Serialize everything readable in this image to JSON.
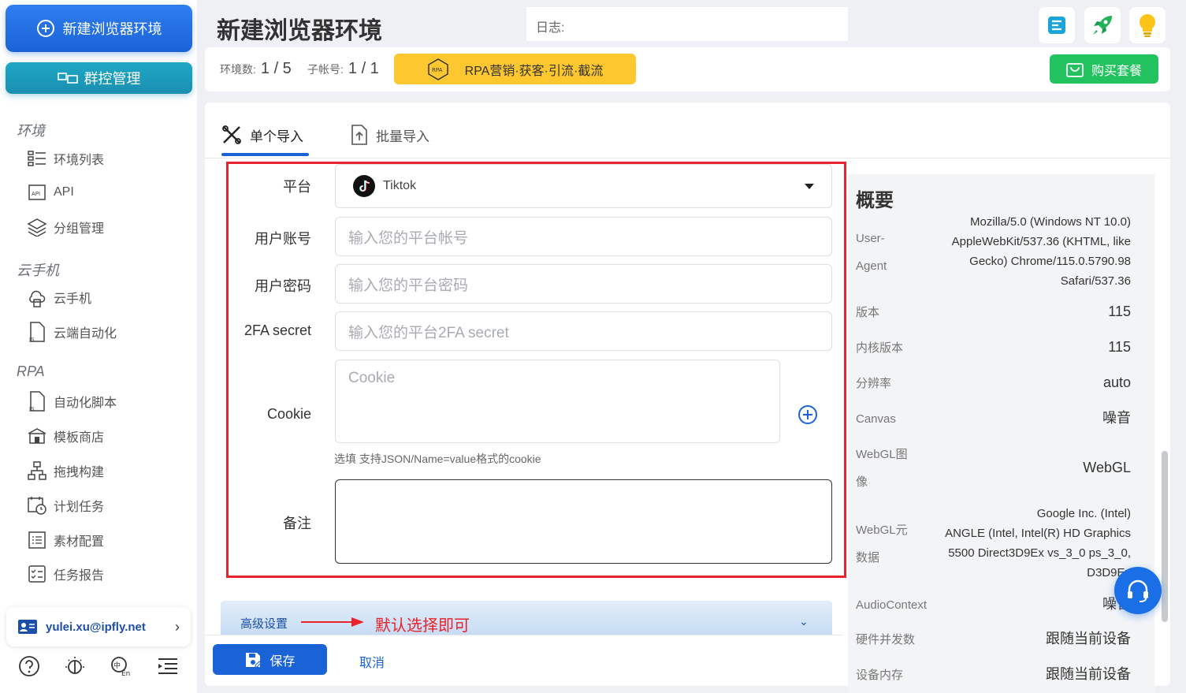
{
  "sidebar": {
    "new_env": "新建浏览器环境",
    "group_ctrl": "群控管理",
    "sections": {
      "env": "环境",
      "cloud_phone": "云手机",
      "rpa": "RPA"
    },
    "items": {
      "env_list": "环境列表",
      "api": "API",
      "group_mgmt": "分组管理",
      "cloud_phone": "云手机",
      "cloud_auto": "云端自动化",
      "auto_script": "自动化脚本",
      "template_store": "模板商店",
      "drag_build": "拖拽构建",
      "schedule": "计划任务",
      "material": "素材配置",
      "report": "任务报告"
    },
    "user_email": "yulei.xu@ipfly.net"
  },
  "header": {
    "title": "新建浏览器环境",
    "log_label": "日志:"
  },
  "stats": {
    "env_label": "环境数:",
    "env_value": "1 / 5",
    "sub_label": "子帐号:",
    "sub_value": "1 / 1",
    "rpa_banner": "RPA营销·获客·引流·截流",
    "buy_label": "购买套餐"
  },
  "tabs": {
    "single": "单个导入",
    "batch": "批量导入"
  },
  "form": {
    "platform_label": "平台",
    "platform_value": "Tiktok",
    "account_label": "用户账号",
    "account_placeholder": "输入您的平台帐号",
    "password_label": "用户密码",
    "password_placeholder": "输入您的平台密码",
    "twofa_label": "2FA secret",
    "twofa_placeholder": "输入您的平台2FA secret",
    "cookie_label": "Cookie",
    "cookie_placeholder": "Cookie",
    "cookie_hint": "选填 支持JSON/Name=value格式的cookie",
    "remark_label": "备注"
  },
  "advanced": {
    "label": "高级设置",
    "note": "默认选择即可"
  },
  "footer": {
    "save": "保存",
    "cancel": "取消"
  },
  "summary": {
    "title": "概要",
    "ua_key_1": "User-",
    "ua_key_2": "Agent",
    "ua_lines": [
      "Mozilla/5.0 (Windows NT 10.0)",
      "AppleWebKit/537.36 (KHTML, like",
      "Gecko) Chrome/115.0.5790.98",
      "Safari/537.36"
    ],
    "version_key": "版本",
    "version_val": "115",
    "kernel_key": "内核版本",
    "kernel_val": "115",
    "resolution_key": "分辨率",
    "resolution_val": "auto",
    "canvas_key": "Canvas",
    "canvas_val": "噪音",
    "webgl_img_key_1": "WebGL图",
    "webgl_img_key_2": "像",
    "webgl_img_val": "WebGL",
    "webgl_meta_key_1": "WebGL元",
    "webgl_meta_key_2": "数据",
    "webgl_meta_lines": [
      "Google Inc. (Intel)",
      "ANGLE (Intel, Intel(R) HD Graphics",
      "5500 Direct3D9Ex vs_3_0 ps_3_0,",
      "D3D9Ex"
    ],
    "audio_key": "AudioContext",
    "audio_val": "噪音",
    "hw_key": "硬件并发数",
    "hw_val": "跟随当前设备",
    "mem_key": "设备内存",
    "mem_val": "跟随当前设备"
  },
  "colors": {
    "primary": "#1a63d6",
    "teal": "#1b8fb0",
    "rpa_yellow": "#fdc72f",
    "buy_green": "#22c25e",
    "highlight_red": "#e8232b"
  }
}
